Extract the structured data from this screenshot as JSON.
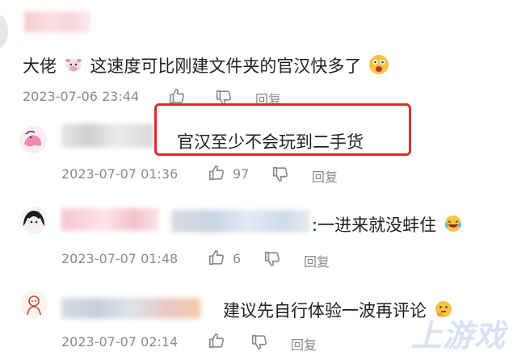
{
  "comments": [
    {
      "text": "大佬",
      "text2": "这速度可比刚建文件夹的官汉快多了",
      "timestamp": "2023-07-06 23:44",
      "reply_label": "回复"
    },
    {
      "text": "官汉至少不会玩到二手货",
      "timestamp": "2023-07-07 01:36",
      "likes": "97",
      "reply_label": "回复"
    },
    {
      "text": ":一进来就没蚌住",
      "timestamp": "2023-07-07 01:48",
      "likes": "6",
      "reply_label": "回复"
    },
    {
      "text": "建议先自行体验一波再评论",
      "timestamp": "2023-07-07 02:14",
      "reply_label": "回复"
    }
  ],
  "watermark": "上游戏",
  "colors": {
    "highlight": "#e12a2a",
    "meta": "#8a8a8a"
  }
}
